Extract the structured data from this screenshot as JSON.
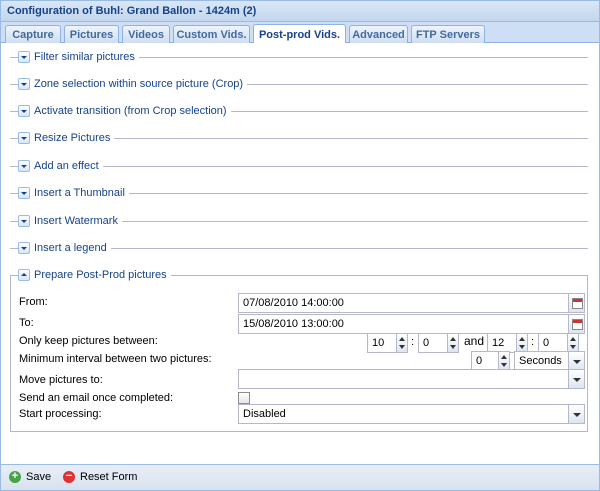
{
  "window": {
    "title": "Configuration of Buhl: Grand Ballon - 1424m (2)"
  },
  "tabs": [
    {
      "label": "Capture"
    },
    {
      "label": "Pictures"
    },
    {
      "label": "Videos"
    },
    {
      "label": "Custom Vids."
    },
    {
      "label": "Post-prod Vids."
    },
    {
      "label": "Advanced"
    },
    {
      "label": "FTP Servers"
    }
  ],
  "active_tab": "Post-prod Vids.",
  "sections": [
    {
      "label": "Filter similar pictures",
      "expanded": false
    },
    {
      "label": "Zone selection within source picture (Crop)",
      "expanded": false
    },
    {
      "label": "Activate transition (from Crop selection)",
      "expanded": false
    },
    {
      "label": "Resize Pictures",
      "expanded": false
    },
    {
      "label": "Add an effect",
      "expanded": false
    },
    {
      "label": "Insert a Thumbnail",
      "expanded": false
    },
    {
      "label": "Insert Watermark",
      "expanded": false
    },
    {
      "label": "Insert a legend",
      "expanded": false
    },
    {
      "label": "Prepare Post-Prod pictures",
      "expanded": true
    }
  ],
  "form": {
    "from": {
      "label": "From:",
      "value": "07/08/2010 14:00:00"
    },
    "to": {
      "label": "To:",
      "value": "15/08/2010 13:00:00"
    },
    "keep_between": {
      "label": "Only keep pictures between:",
      "start_hour": "10",
      "start_min": "0",
      "colon": ":",
      "and_label": "and",
      "end_hour": "12",
      "end_min": "0"
    },
    "min_interval": {
      "label": "Minimum interval between two pictures:",
      "value": "0",
      "unit": "Seconds"
    },
    "move_to": {
      "label": "Move pictures to:",
      "value": ""
    },
    "send_email": {
      "label": "Send an email once completed:",
      "checked": false
    },
    "start_processing": {
      "label": "Start processing:",
      "value": "Disabled"
    }
  },
  "footer": {
    "save_label": "Save",
    "reset_label": "Reset Form"
  }
}
